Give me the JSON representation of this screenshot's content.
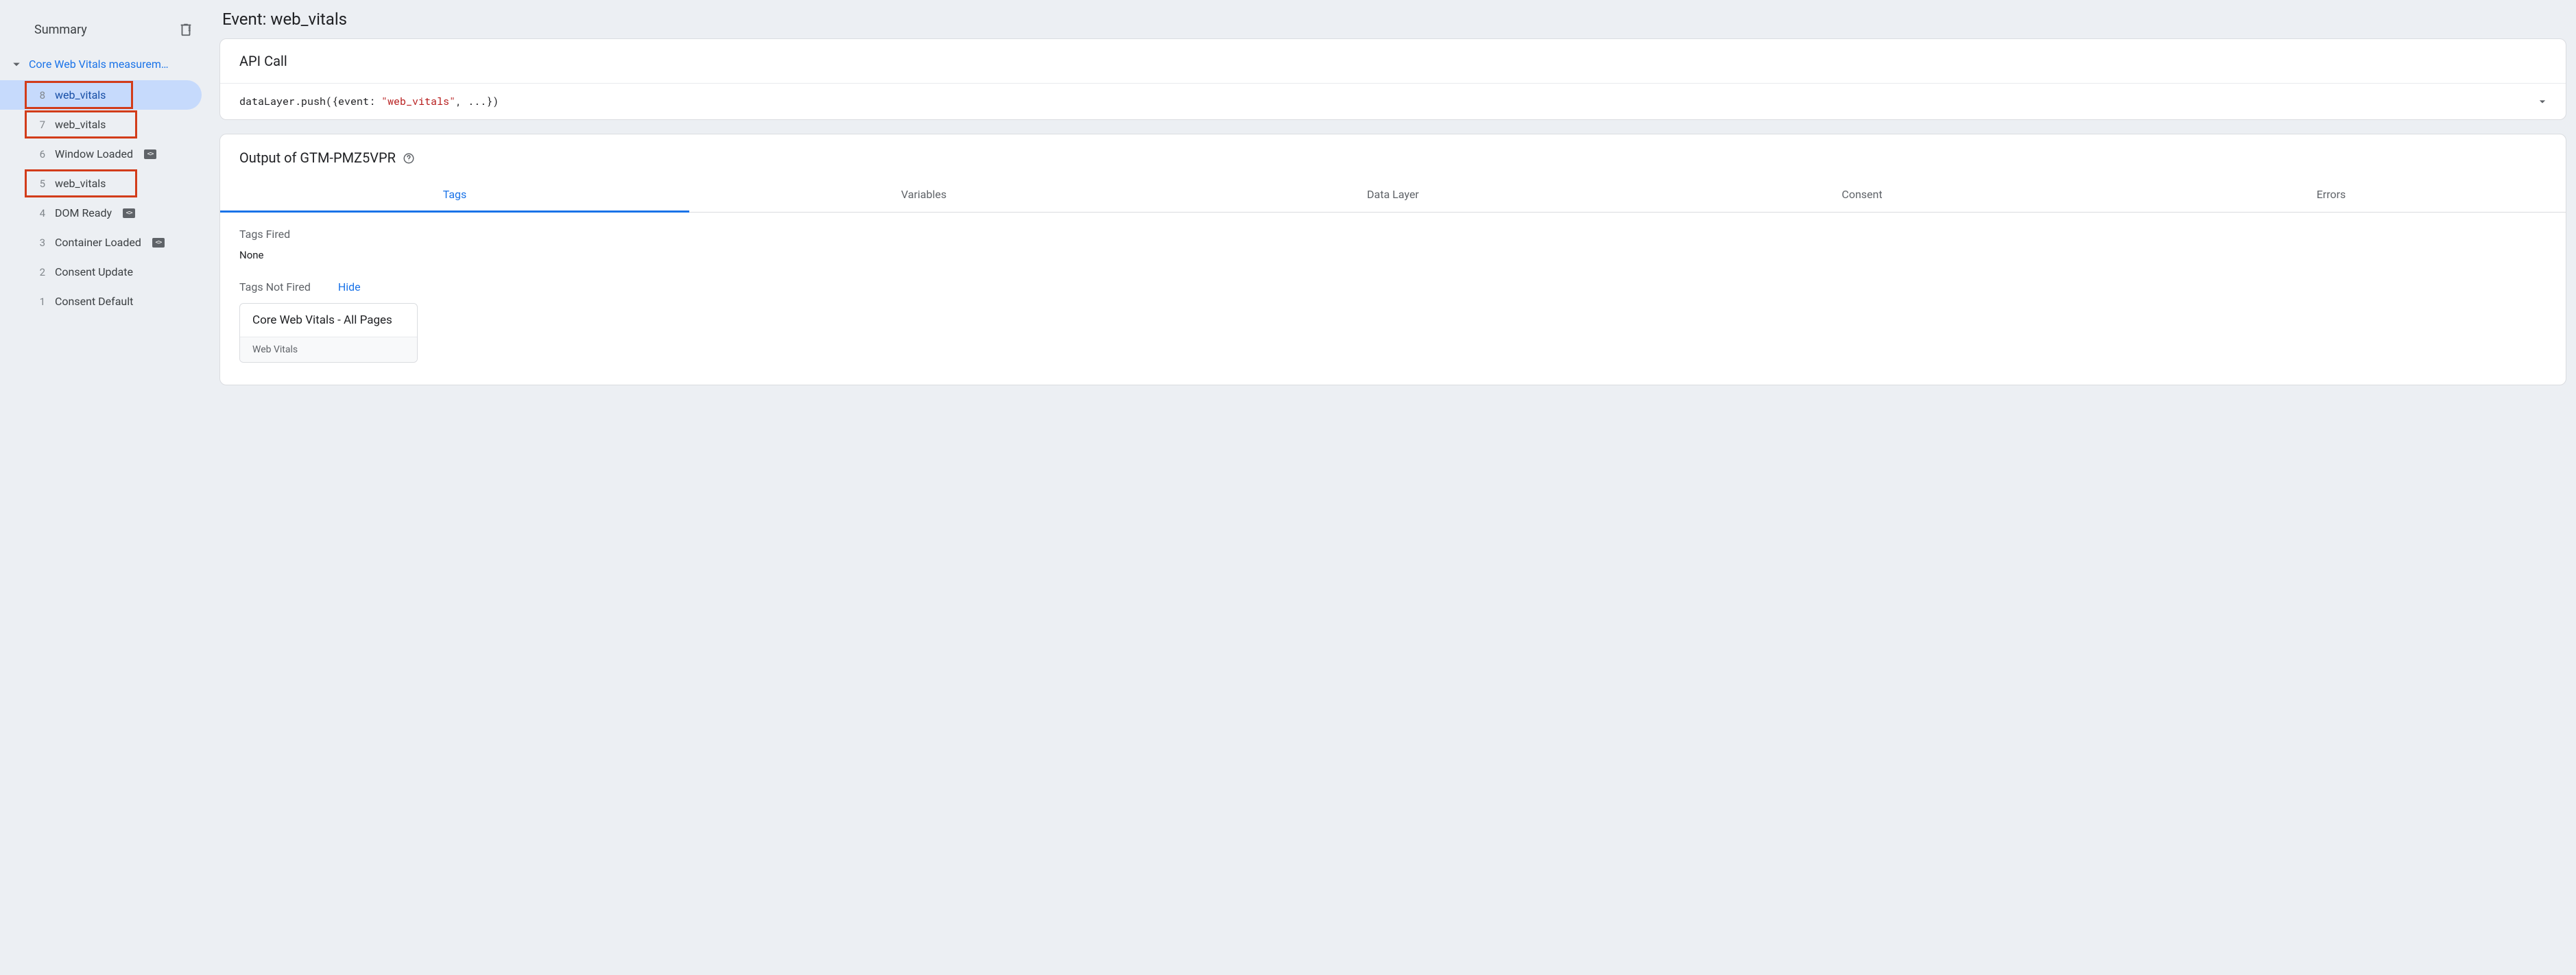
{
  "sidebar": {
    "summary_label": "Summary",
    "clear_icon": "clear-list-icon",
    "group_title": "Core Web Vitals measurem…",
    "events": [
      {
        "num": "8",
        "label": "web_vitals",
        "selected": true,
        "has_code_badge": false,
        "highlight": true
      },
      {
        "num": "7",
        "label": "web_vitals",
        "selected": false,
        "has_code_badge": false,
        "highlight": true
      },
      {
        "num": "6",
        "label": "Window Loaded",
        "selected": false,
        "has_code_badge": true,
        "highlight": false
      },
      {
        "num": "5",
        "label": "web_vitals",
        "selected": false,
        "has_code_badge": false,
        "highlight": true
      },
      {
        "num": "4",
        "label": "DOM Ready",
        "selected": false,
        "has_code_badge": true,
        "highlight": false
      },
      {
        "num": "3",
        "label": "Container Loaded",
        "selected": false,
        "has_code_badge": true,
        "highlight": false
      },
      {
        "num": "2",
        "label": "Consent Update",
        "selected": false,
        "has_code_badge": false,
        "highlight": false
      },
      {
        "num": "1",
        "label": "Consent Default",
        "selected": false,
        "has_code_badge": false,
        "highlight": false
      }
    ]
  },
  "main": {
    "event_title": "Event: web_vitals",
    "api_call": {
      "title": "API Call",
      "code_prefix": "dataLayer.push({event: ",
      "code_string": "\"web_vitals\"",
      "code_suffix": ", ...})"
    },
    "output": {
      "title": "Output of GTM-PMZ5VPR",
      "tabs": [
        "Tags",
        "Variables",
        "Data Layer",
        "Consent",
        "Errors"
      ],
      "active_tab": 0,
      "tags_fired_label": "Tags Fired",
      "tags_fired_value": "None",
      "tags_not_fired_label": "Tags Not Fired",
      "hide_label": "Hide",
      "not_fired_tag": {
        "name": "Core Web Vitals - All Pages",
        "type": "Web Vitals"
      }
    }
  }
}
